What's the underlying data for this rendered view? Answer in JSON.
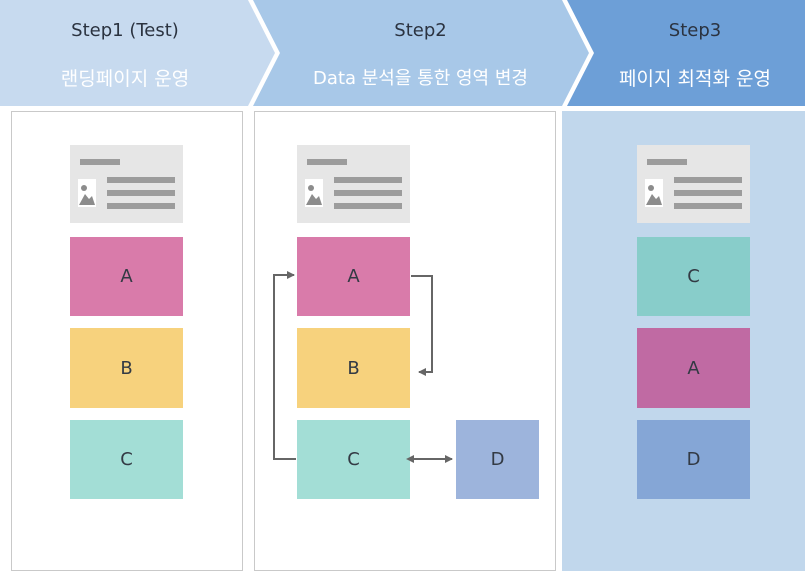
{
  "steps": [
    {
      "step": "Step1 (Test)",
      "subtitle": "랜딩페이지 운영"
    },
    {
      "step": "Step2",
      "subtitle": "Data 분석을 통한 영역 변경"
    },
    {
      "step": "Step3",
      "subtitle": "페이지 최적화 운영"
    }
  ],
  "colors": {
    "step1_header": "#c7daef",
    "step2_header": "#a8c8e8",
    "step3_header": "#6d9fd7",
    "step3_panel": "#c1d7ec",
    "block_a": "#d97baa",
    "block_a_step3": "#c06aa3",
    "block_b": "#f7d27d",
    "block_c": "#a3ded6",
    "block_c_step3": "#88cdca",
    "block_d": "#9db4dc",
    "block_d_step3": "#85a6d6"
  },
  "columns": [
    {
      "blocks": [
        {
          "label": "A"
        },
        {
          "label": "B"
        },
        {
          "label": "C"
        }
      ]
    },
    {
      "blocks": [
        {
          "label": "A"
        },
        {
          "label": "B"
        },
        {
          "label": "C"
        },
        {
          "label": "D"
        }
      ]
    },
    {
      "blocks": [
        {
          "label": "C"
        },
        {
          "label": "A"
        },
        {
          "label": "D"
        }
      ]
    }
  ]
}
